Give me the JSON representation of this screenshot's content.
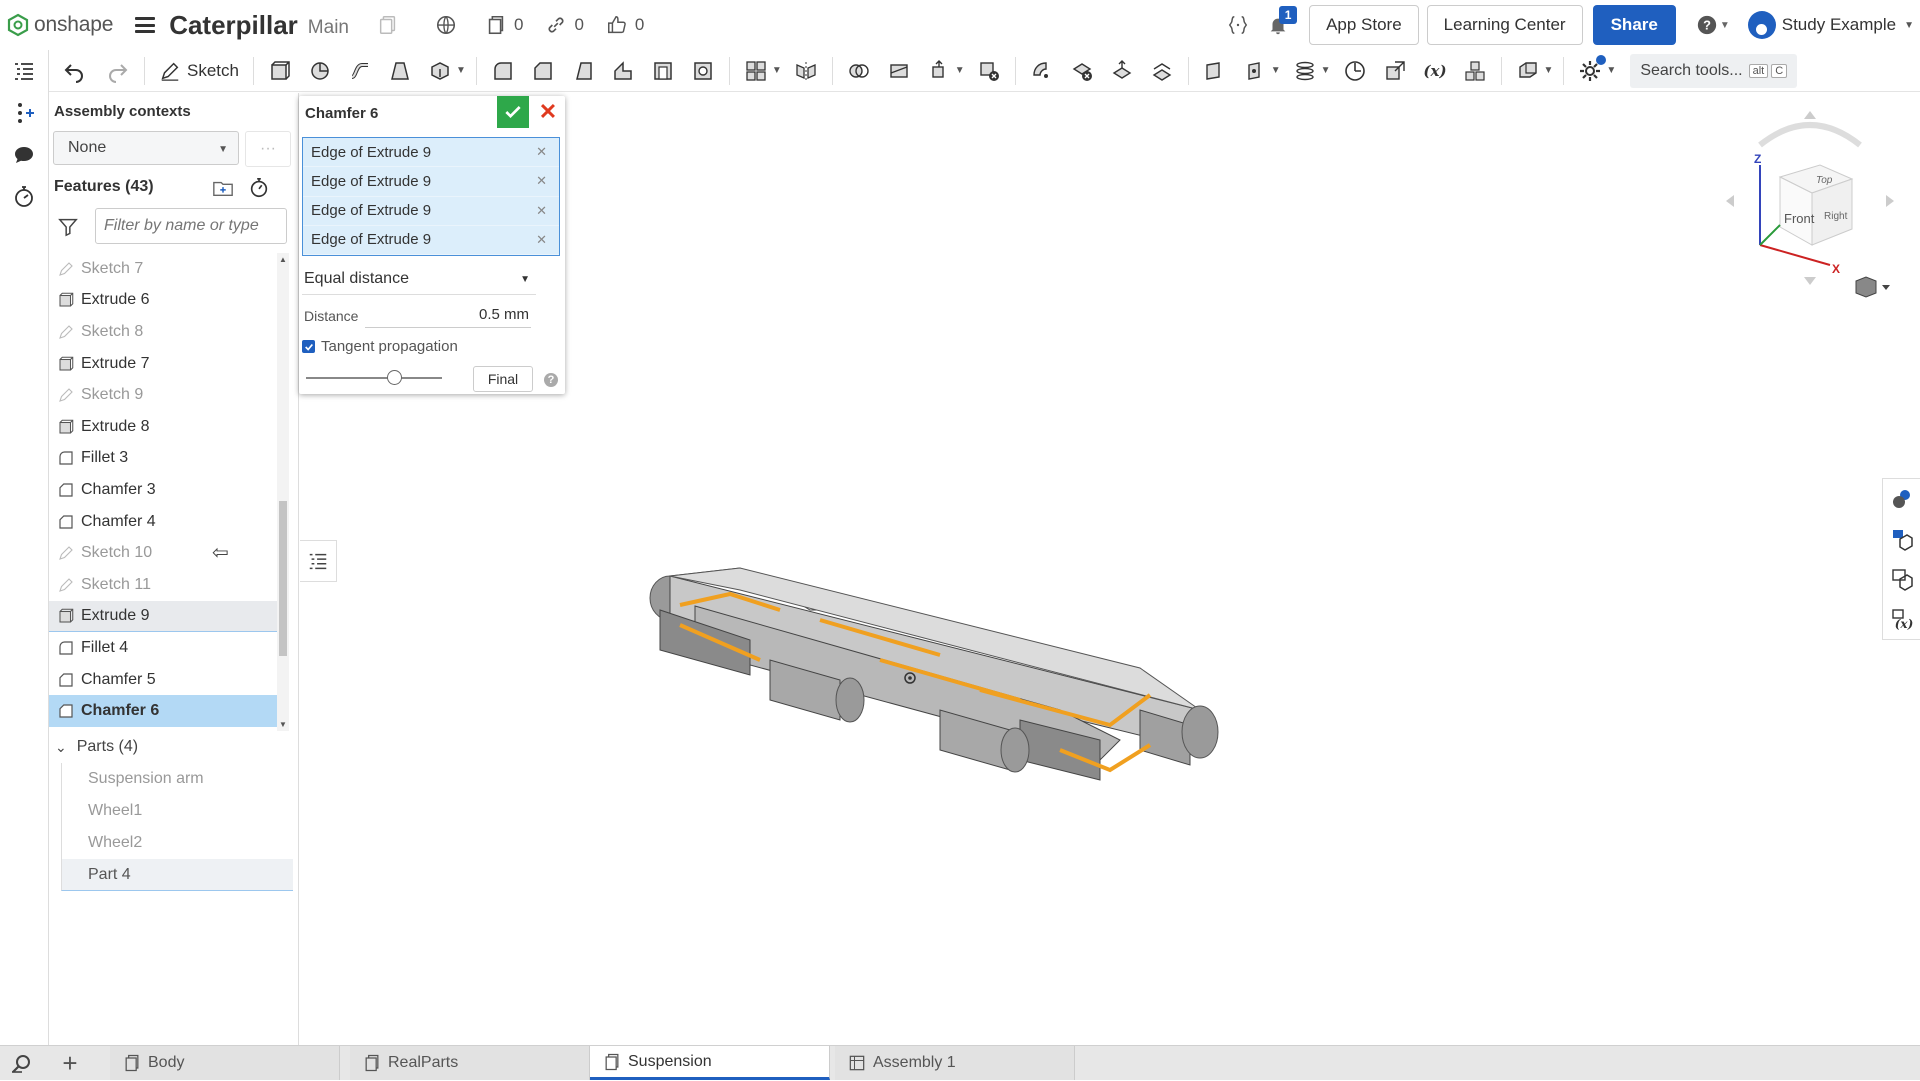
{
  "app": {
    "logo_text": "onshape",
    "doc_title": "Caterpillar",
    "branch": "Main"
  },
  "top": {
    "versions_count": "0",
    "links_count": "0",
    "likes_count": "0",
    "notifications_count": "1",
    "app_store": "App Store",
    "learning_center": "Learning Center",
    "share": "Share",
    "user_name": "Study Example"
  },
  "toolbar": {
    "sketch_label": "Sketch",
    "search_label": "Search tools...",
    "search_key1": "alt",
    "search_key2": "C"
  },
  "panel": {
    "assembly_contexts_title": "Assembly contexts",
    "context_value": "None",
    "context_more": "···",
    "features_header": "Features (43)",
    "filter_placeholder": "Filter by name or type",
    "features": [
      {
        "label": "Sketch 7",
        "type": "sketch"
      },
      {
        "label": "Extrude 6",
        "type": "extrude"
      },
      {
        "label": "Sketch 8",
        "type": "sketch"
      },
      {
        "label": "Extrude 7",
        "type": "extrude"
      },
      {
        "label": "Sketch 9",
        "type": "sketch"
      },
      {
        "label": "Extrude 8",
        "type": "extrude"
      },
      {
        "label": "Fillet 3",
        "type": "fillet"
      },
      {
        "label": "Chamfer 3",
        "type": "chamfer"
      },
      {
        "label": "Chamfer 4",
        "type": "chamfer"
      },
      {
        "label": "Sketch 10",
        "type": "sketch"
      },
      {
        "label": "Sketch 11",
        "type": "sketch"
      },
      {
        "label": "Extrude 9",
        "type": "extrude"
      },
      {
        "label": "Fillet 4",
        "type": "fillet"
      },
      {
        "label": "Chamfer 5",
        "type": "chamfer"
      },
      {
        "label": "Chamfer 6",
        "type": "chamfer"
      }
    ],
    "parts_header": "Parts (4)",
    "parts": [
      "Suspension arm",
      "Wheel1",
      "Wheel2",
      "Part 4"
    ]
  },
  "dialog": {
    "title": "Chamfer 6",
    "edges": [
      "Edge of Extrude 9",
      "Edge of Extrude 9",
      "Edge of Extrude 9",
      "Edge of Extrude 9"
    ],
    "measure_type": "Equal distance",
    "distance_label": "Distance",
    "distance_value": "0.5 mm",
    "tangent_label": "Tangent propagation",
    "tangent_checked": true,
    "final_label": "Final"
  },
  "viewcube": {
    "top": "Top",
    "front": "Front",
    "right": "Right",
    "axis_x": "X",
    "axis_z": "Z"
  },
  "tabs": [
    {
      "label": "Body",
      "active": false
    },
    {
      "label": "RealParts",
      "active": false
    },
    {
      "label": "Suspension",
      "active": true
    },
    {
      "label": "Assembly 1",
      "active": false
    }
  ],
  "colors": {
    "accent": "#1f5fbf",
    "confirm": "#2ea84a",
    "cancel": "#e03a1f",
    "selection": "#b3d9f5",
    "edge_highlight": "#f0a020"
  }
}
